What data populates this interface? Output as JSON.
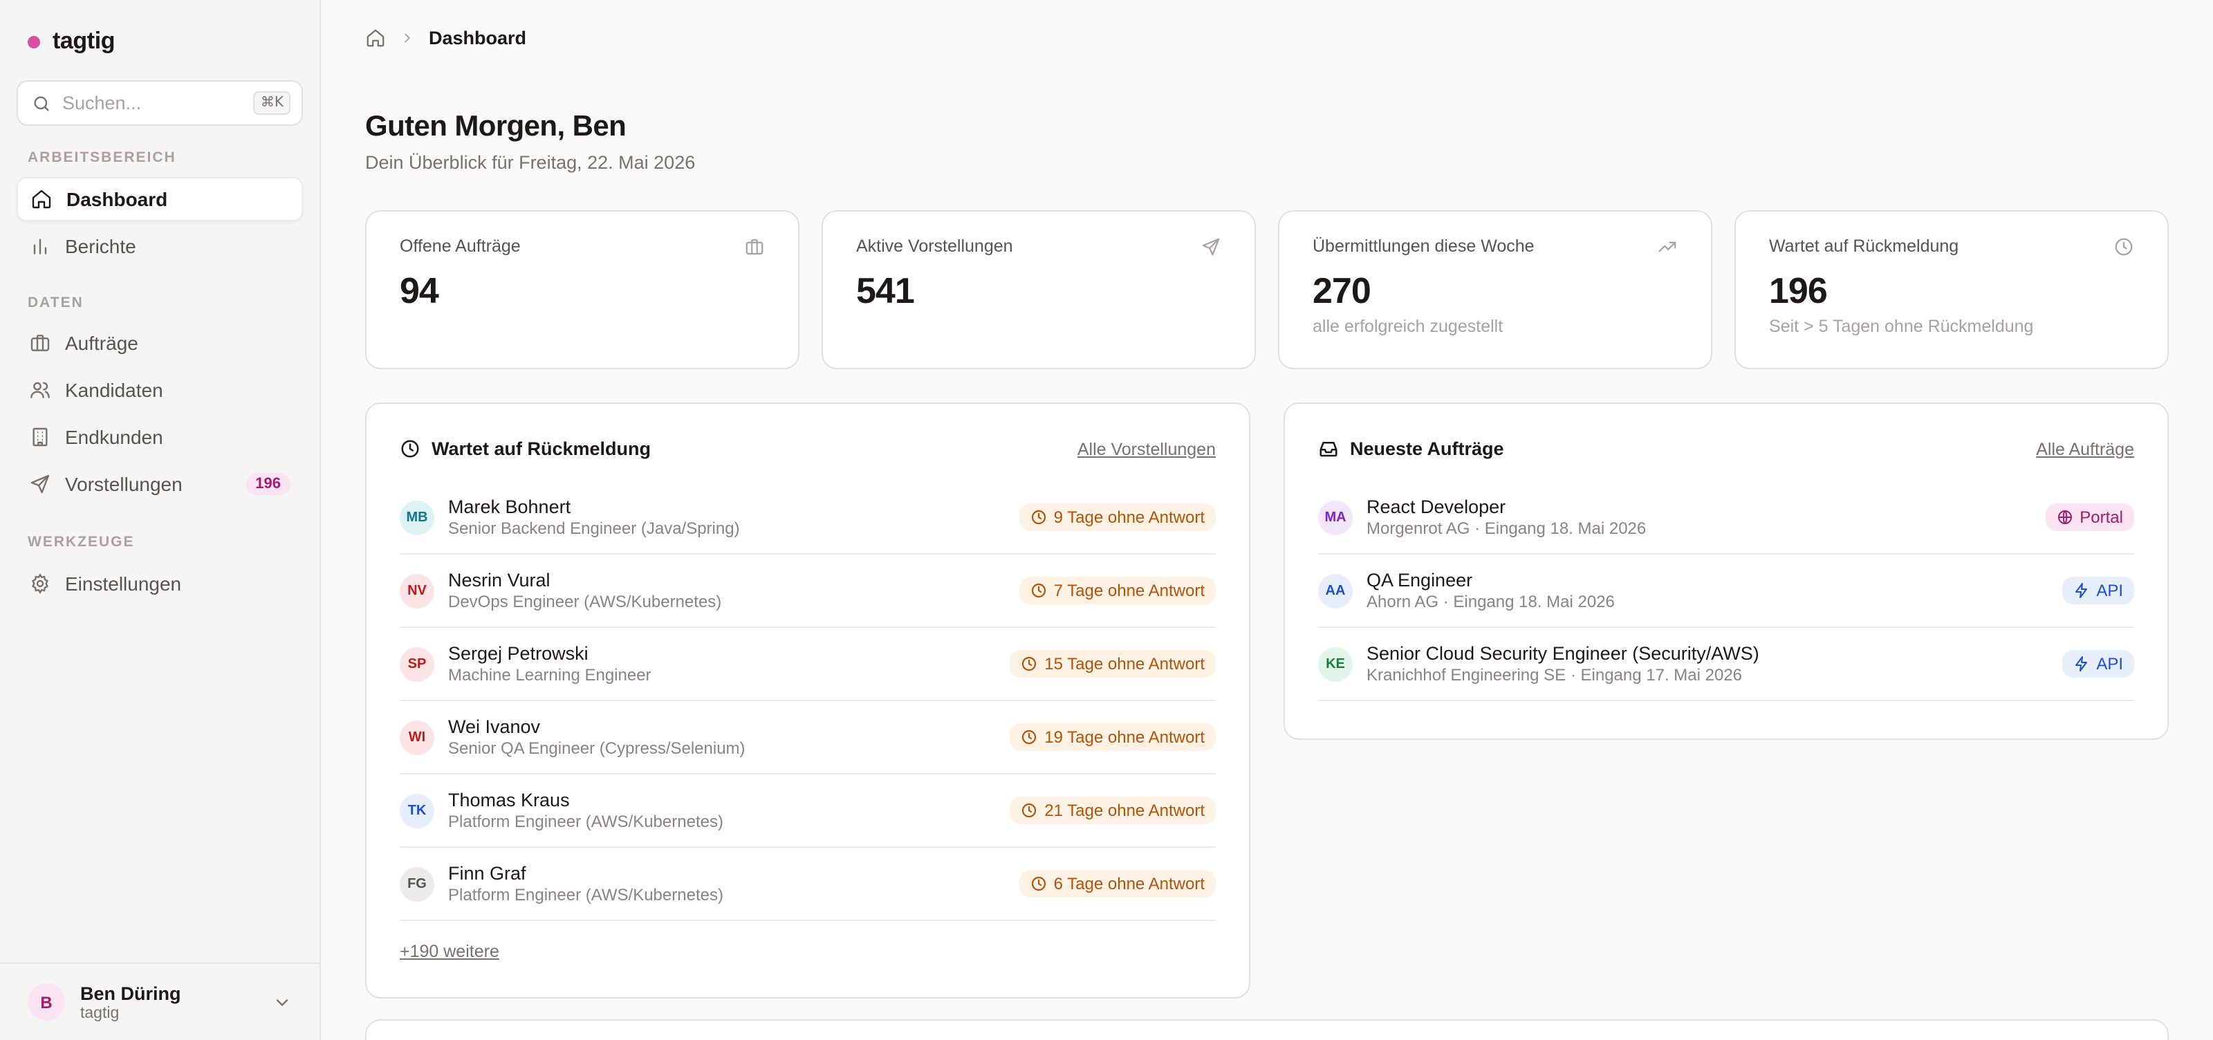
{
  "brand": {
    "name": "tagtig",
    "color": "#db4fa1"
  },
  "search": {
    "placeholder": "Suchen...",
    "shortcut": "⌘K"
  },
  "sidebar": {
    "sections": [
      {
        "label": "Arbeitsbereich"
      },
      {
        "label": "Daten"
      },
      {
        "label": "Werkzeuge"
      }
    ],
    "items": [
      {
        "label": "Dashboard",
        "icon": "home-icon",
        "active": true
      },
      {
        "label": "Berichte",
        "icon": "bar-chart-icon"
      },
      {
        "label": "Aufträge",
        "icon": "briefcase-icon"
      },
      {
        "label": "Kandidaten",
        "icon": "users-icon"
      },
      {
        "label": "Endkunden",
        "icon": "building-icon"
      },
      {
        "label": "Vorstellungen",
        "icon": "send-icon",
        "badge": "196"
      },
      {
        "label": "Einstellungen",
        "icon": "gear-icon"
      }
    ]
  },
  "user": {
    "initial": "B",
    "name": "Ben Düring",
    "org": "tagtig"
  },
  "breadcrumb": {
    "current": "Dashboard"
  },
  "header": {
    "greeting": "Guten Morgen, Ben",
    "subline": "Dein Überblick für Freitag, 22. Mai 2026"
  },
  "stats": [
    {
      "label": "Offene Aufträge",
      "value": "94",
      "note": "",
      "icon": "briefcase-icon"
    },
    {
      "label": "Aktive Vorstellungen",
      "value": "541",
      "note": "",
      "icon": "send-icon"
    },
    {
      "label": "Übermittlungen diese Woche",
      "value": "270",
      "note": "alle erfolgreich zugestellt",
      "icon": "trending-up-icon"
    },
    {
      "label": "Wartet auf Rückmeldung",
      "value": "196",
      "note": "Seit > 5 Tagen ohne Rückmeldung",
      "icon": "clock-icon"
    }
  ],
  "waiting": {
    "title": "Wartet auf Rückmeldung",
    "link": "Alle Vorstellungen",
    "more": "+190 weitere",
    "rows": [
      {
        "initials": "MB",
        "name": "Marek Bohnert",
        "role": "Senior Backend Engineer (Java/Spring)",
        "status": "9 Tage ohne Antwort",
        "color": "#0e7490",
        "bg": "#dcf2f5"
      },
      {
        "initials": "NV",
        "name": "Nesrin Vural",
        "role": "DevOps Engineer (AWS/Kubernetes)",
        "status": "7 Tage ohne Antwort",
        "color": "#b91c1c",
        "bg": "#fde4e4"
      },
      {
        "initials": "SP",
        "name": "Sergej Petrowski",
        "role": "Machine Learning Engineer",
        "status": "15 Tage ohne Antwort",
        "color": "#b91c1c",
        "bg": "#fde4e4"
      },
      {
        "initials": "WI",
        "name": "Wei Ivanov",
        "role": "Senior QA Engineer (Cypress/Selenium)",
        "status": "19 Tage ohne Antwort",
        "color": "#b91c1c",
        "bg": "#fde4e4"
      },
      {
        "initials": "TK",
        "name": "Thomas Kraus",
        "role": "Platform Engineer (AWS/Kubernetes)",
        "status": "21 Tage ohne Antwort",
        "color": "#1d4ed8",
        "bg": "#e6eefc"
      },
      {
        "initials": "FG",
        "name": "Finn Graf",
        "role": "Platform Engineer (AWS/Kubernetes)",
        "status": "6 Tage ohne Antwort",
        "color": "#57534e",
        "bg": "#ecebe9"
      }
    ]
  },
  "orders": {
    "title": "Neueste Aufträge",
    "link": "Alle Aufträge",
    "rows": [
      {
        "initials": "MA",
        "name": "React Developer",
        "meta": "Morgenrot AG · Eingang 18. Mai 2026",
        "tag": "Portal",
        "tag_icon": "globe-icon",
        "kind": "portal",
        "color": "#7e22ce",
        "bg": "#f1e6fb"
      },
      {
        "initials": "AA",
        "name": "QA Engineer",
        "meta": "Ahorn AG · Eingang 18. Mai 2026",
        "tag": "API",
        "tag_icon": "bolt-icon",
        "kind": "api",
        "color": "#1d4ed8",
        "bg": "#e6eefc"
      },
      {
        "initials": "KE",
        "name": "Senior Cloud Security Engineer (Security/AWS)",
        "meta": "Kranichhof Engineering SE · Eingang 17. Mai 2026",
        "tag": "API",
        "tag_icon": "bolt-icon",
        "kind": "api",
        "color": "#15803d",
        "bg": "#e3f5e9"
      }
    ]
  }
}
